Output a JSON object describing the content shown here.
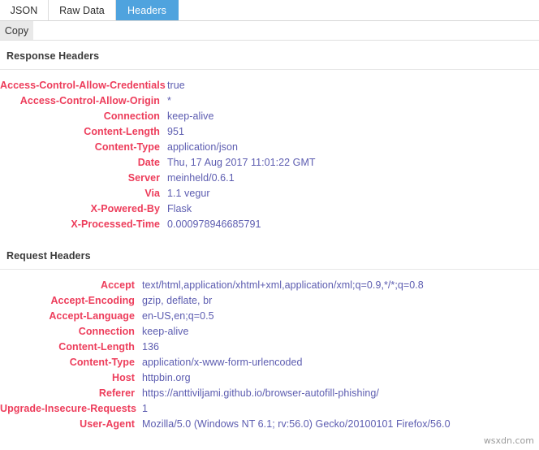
{
  "tabs": [
    {
      "label": "JSON",
      "active": false
    },
    {
      "label": "Raw Data",
      "active": false
    },
    {
      "label": "Headers",
      "active": true
    }
  ],
  "toolbar": {
    "copy_label": "Copy"
  },
  "colors": {
    "active_tab_bg": "#4fa3de",
    "header_name": "#ed3d5b",
    "header_value": "#5c5cb0",
    "section_title": "#3b3b3b",
    "copy_button_bg": "#e9e9e9"
  },
  "response_section": {
    "title": "Response Headers",
    "headers": [
      {
        "name": "Access-Control-Allow-Credentials",
        "value": "true"
      },
      {
        "name": "Access-Control-Allow-Origin",
        "value": "*"
      },
      {
        "name": "Connection",
        "value": "keep-alive"
      },
      {
        "name": "Content-Length",
        "value": "951"
      },
      {
        "name": "Content-Type",
        "value": "application/json"
      },
      {
        "name": "Date",
        "value": "Thu, 17 Aug 2017 11:01:22 GMT"
      },
      {
        "name": "Server",
        "value": "meinheld/0.6.1"
      },
      {
        "name": "Via",
        "value": "1.1 vegur"
      },
      {
        "name": "X-Powered-By",
        "value": "Flask"
      },
      {
        "name": "X-Processed-Time",
        "value": "0.000978946685791"
      }
    ]
  },
  "request_section": {
    "title": "Request Headers",
    "headers": [
      {
        "name": "Accept",
        "value": "text/html,application/xhtml+xml,application/xml;q=0.9,*/*;q=0.8"
      },
      {
        "name": "Accept-Encoding",
        "value": "gzip, deflate, br"
      },
      {
        "name": "Accept-Language",
        "value": "en-US,en;q=0.5"
      },
      {
        "name": "Connection",
        "value": "keep-alive"
      },
      {
        "name": "Content-Length",
        "value": "136"
      },
      {
        "name": "Content-Type",
        "value": "application/x-www-form-urlencoded"
      },
      {
        "name": "Host",
        "value": "httpbin.org"
      },
      {
        "name": "Referer",
        "value": "https://anttiviljami.github.io/browser-autofill-phishing/"
      },
      {
        "name": "Upgrade-Insecure-Requests",
        "value": "1"
      },
      {
        "name": "User-Agent",
        "value": "Mozilla/5.0 (Windows NT 6.1; rv:56.0) Gecko/20100101 Firefox/56.0"
      }
    ]
  },
  "watermark": {
    "text": "wsxdn.com"
  }
}
